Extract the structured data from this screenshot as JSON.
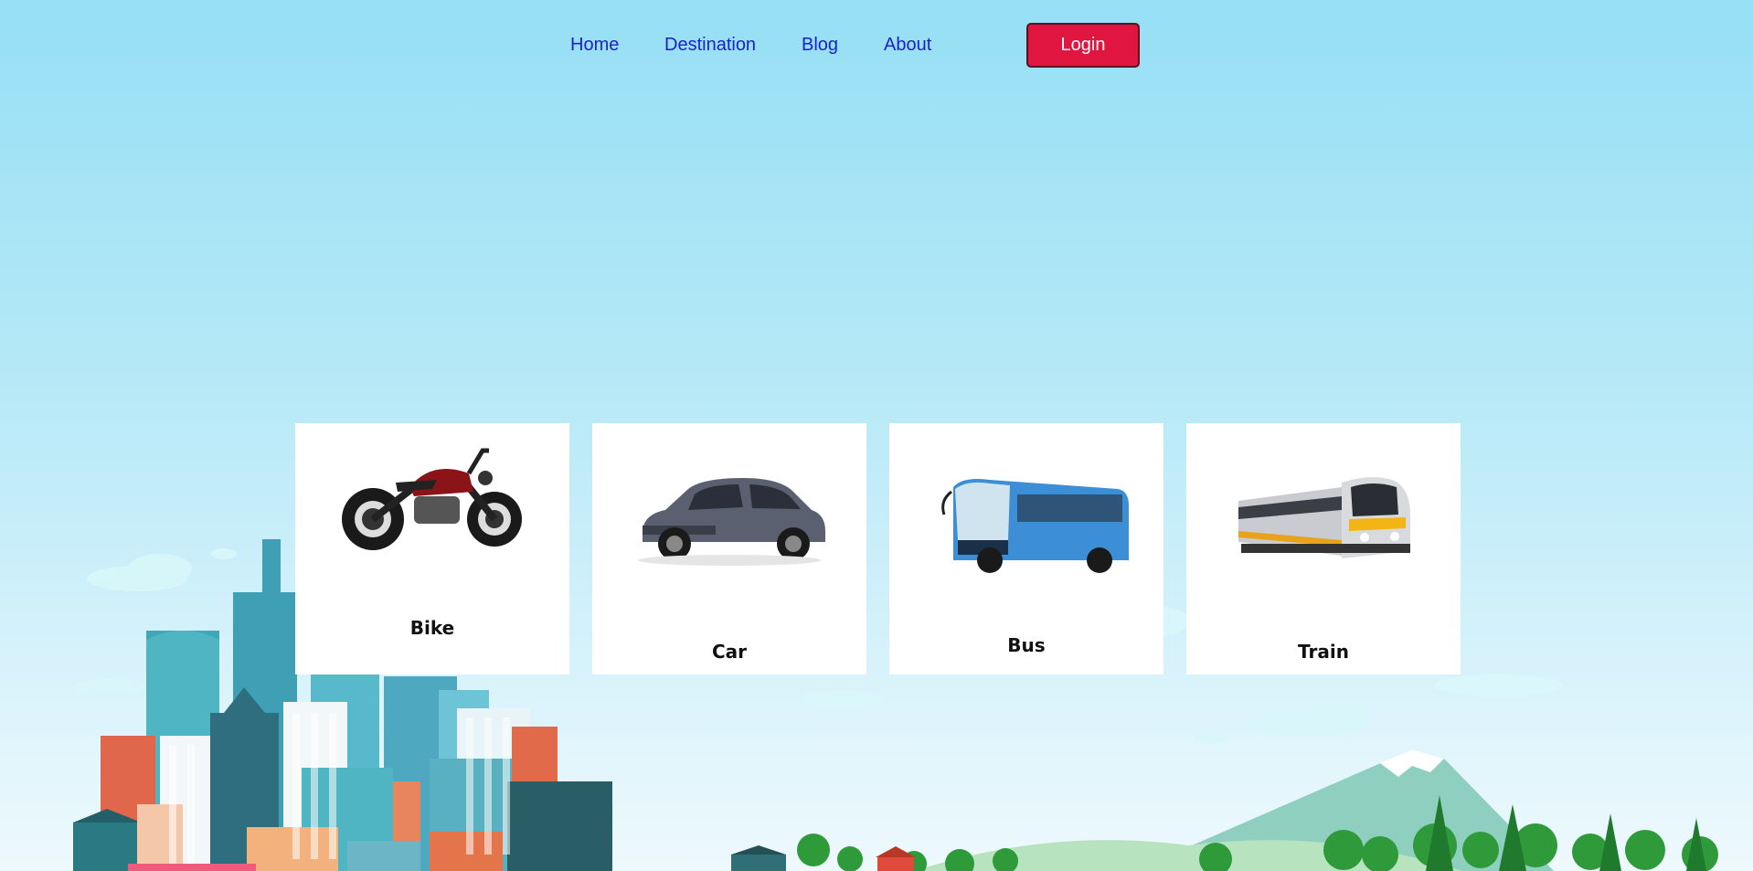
{
  "nav": {
    "items": [
      {
        "label": "Home"
      },
      {
        "label": "Destination"
      },
      {
        "label": "Blog"
      },
      {
        "label": "About"
      }
    ],
    "login_label": "Login"
  },
  "cards": [
    {
      "label": "Bike",
      "icon": "motorcycle-image"
    },
    {
      "label": "Car",
      "icon": "car-image"
    },
    {
      "label": "Bus",
      "icon": "bus-image"
    },
    {
      "label": "Train",
      "icon": "train-image"
    }
  ],
  "colors": {
    "nav_link": "#1a23c9",
    "login_bg": "#e01540",
    "sky_top": "#96dff5"
  }
}
